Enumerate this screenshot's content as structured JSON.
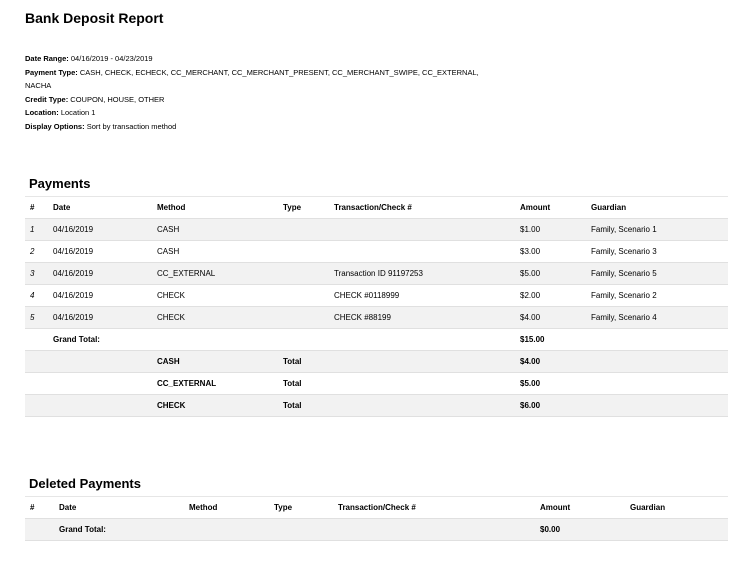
{
  "title": "Bank Deposit Report",
  "meta": [
    {
      "label": "Date Range:",
      "value": "04/16/2019 - 04/23/2019"
    },
    {
      "label": "Payment Type:",
      "value": "CASH, CHECK, ECHECK, CC_MERCHANT, CC_MERCHANT_PRESENT, CC_MERCHANT_SWIPE, CC_EXTERNAL, NACHA"
    },
    {
      "label": "Credit Type:",
      "value": "COUPON, HOUSE, OTHER"
    },
    {
      "label": "Location:",
      "value": "Location 1"
    },
    {
      "label": "Display Options:",
      "value": "Sort by transaction method"
    }
  ],
  "payments": {
    "heading": "Payments",
    "columns": [
      "#",
      "Date",
      "Method",
      "Type",
      "Transaction/Check #",
      "Amount",
      "Guardian"
    ],
    "rows": [
      [
        "1",
        "04/16/2019",
        "CASH",
        "",
        "",
        "$1.00",
        "Family, Scenario 1"
      ],
      [
        "2",
        "04/16/2019",
        "CASH",
        "",
        "",
        "$3.00",
        "Family, Scenario 3"
      ],
      [
        "3",
        "04/16/2019",
        "CC_EXTERNAL",
        "",
        "Transaction ID 91197253",
        "$5.00",
        "Family, Scenario 5"
      ],
      [
        "4",
        "04/16/2019",
        "CHECK",
        "",
        "CHECK #0118999",
        "$2.00",
        "Family, Scenario 2"
      ],
      [
        "5",
        "04/16/2019",
        "CHECK",
        "",
        "CHECK #88199",
        "$4.00",
        "Family, Scenario 4"
      ]
    ],
    "grand_total_label": "Grand Total:",
    "grand_total": "$15.00",
    "subtotals": [
      {
        "method": "CASH",
        "label": "Total",
        "amount": "$4.00"
      },
      {
        "method": "CC_EXTERNAL",
        "label": "Total",
        "amount": "$5.00"
      },
      {
        "method": "CHECK",
        "label": "Total",
        "amount": "$6.00"
      }
    ]
  },
  "deleted": {
    "heading": "Deleted Payments",
    "columns": [
      "#",
      "Date",
      "Method",
      "Type",
      "Transaction/Check #",
      "Amount",
      "Guardian"
    ],
    "grand_total_label": "Grand Total:",
    "grand_total": "$0.00"
  }
}
